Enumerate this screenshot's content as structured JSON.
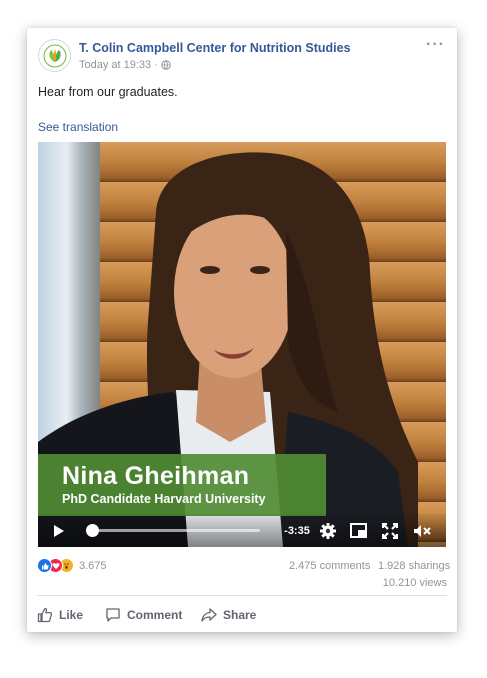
{
  "post": {
    "page_name": "T. Colin Campbell Center for Nutrition Studies",
    "timestamp": "Today at 19:33",
    "separator": "·",
    "text": "Hear from our graduates.",
    "see_translation": "See translation",
    "more_label": "···"
  },
  "video": {
    "person_name": "Nina Gheihman",
    "person_title": "PhD Candidate Harvard University",
    "time_remaining": "-3:35",
    "progress": 0.0,
    "overlay_color": "#4f8c34"
  },
  "stats": {
    "reaction_count": "3.675",
    "comments": "2.475 comments",
    "sharings": "1.928 sharings",
    "views": "10.210 views"
  },
  "actions": {
    "like": "Like",
    "comment": "Comment",
    "share": "Share"
  },
  "icons": {
    "avatar": "leaf-logo-icon",
    "privacy": "globe-icon",
    "play": "play-icon",
    "settings": "gear-icon",
    "pip": "picture-in-picture-icon",
    "fullscreen": "fullscreen-icon",
    "mute": "mute-icon",
    "reactions": [
      "like-reaction-icon",
      "love-reaction-icon",
      "wow-reaction-icon"
    ]
  },
  "colors": {
    "link": "#365899",
    "meta": "#90949c",
    "like_blue": "#1b74e4"
  }
}
